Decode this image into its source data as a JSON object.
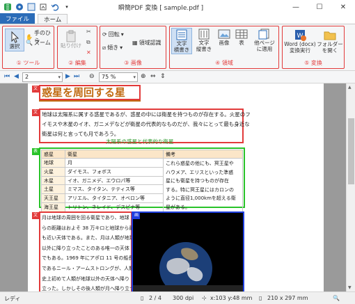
{
  "window": {
    "title": "瞬簡PDF 変換 [ sample.pdf ]"
  },
  "tabs": {
    "file": "ファイル",
    "home": "ホーム"
  },
  "ribbon": {
    "tool": {
      "label": "① ツール",
      "select": "選択",
      "hand": "手のひら",
      "zoom": "ズーム"
    },
    "edit": {
      "label": "② 編集",
      "paste": "貼り付け"
    },
    "image": {
      "label": "③ 画像",
      "rotate": "回転",
      "tilt": "傾き",
      "area": "領域認識"
    },
    "region": {
      "label": "④ 領域",
      "text_h": "文字\n横書き",
      "text_v": "文字\n縦書き",
      "image": "画像",
      "table": "表",
      "apply": "他ページ\nに適用"
    },
    "convert": {
      "label": "⑤ 変換",
      "word": "Word (docx)\n変換実行",
      "folder": "フォルダー\nを開く"
    }
  },
  "nav": {
    "page": "2",
    "zoom": "75 %"
  },
  "doc": {
    "heading": "惑星を周回する星",
    "para1": [
      "地球は太陽系に属する惑星であるが、惑星の中には衛星を持つものが存在する。火星のフ",
      "イモスや木星のイオ、ガニメデなどが衛星の代表的なものだが、我々にとって最も身近な",
      "衛星は何と言っても月であろう。"
    ],
    "table_caption": "太陽系の惑星と代表的な衛星",
    "table_head": [
      "惑星",
      "衛星",
      "備考"
    ],
    "table_rows": [
      [
        "地球",
        "月"
      ],
      [
        "火星",
        "ダイモス、フォボス"
      ],
      [
        "木星",
        "イオ、ガニメデ、エウロパ等"
      ],
      [
        "土星",
        "ミマス、タイタン、テティス等"
      ],
      [
        "天王星",
        "アリエル、タイタニア、オベロン等"
      ],
      [
        "海王星",
        "トリトン、ネレイド、デスピナ等"
      ]
    ],
    "table_note": [
      "これら惑星の他にも、冥王星や",
      "ハウメア、エリスといった準惑",
      "星にも衛星を持つものが存在",
      "する。特に冥王星にはカロンの",
      "ように直径1,000kmを超える衛",
      "星がある。"
    ],
    "para2": [
      "月は地球の周囲を回る衛星であり、地球",
      "らの距離はおよそ 38 万キロと地球から最",
      "も近い天体である。また、月は人類が地球",
      "以外に降り立ったことのある唯一の天体",
      "でもある。1969 年にアポロ 11 号の船長",
      "であるニール・アームストロングが、人類",
      "史上初めて人類が地球以外の天体へ降り",
      "立った。しかしその後人類が月へ降り立つ"
    ]
  },
  "status": {
    "mode": "レディ",
    "page": "2 / 4",
    "dpi": "300 dpi",
    "coord": "x:103 y:48 mm",
    "size": "210 x 297 mm"
  },
  "colors": {
    "accent": "#2b6cb8",
    "group": "#e23a3a",
    "text_box": "#e23a3a",
    "table_box": "#29c329",
    "image_box": "#1f3fe0",
    "heading": "#c06a10"
  }
}
